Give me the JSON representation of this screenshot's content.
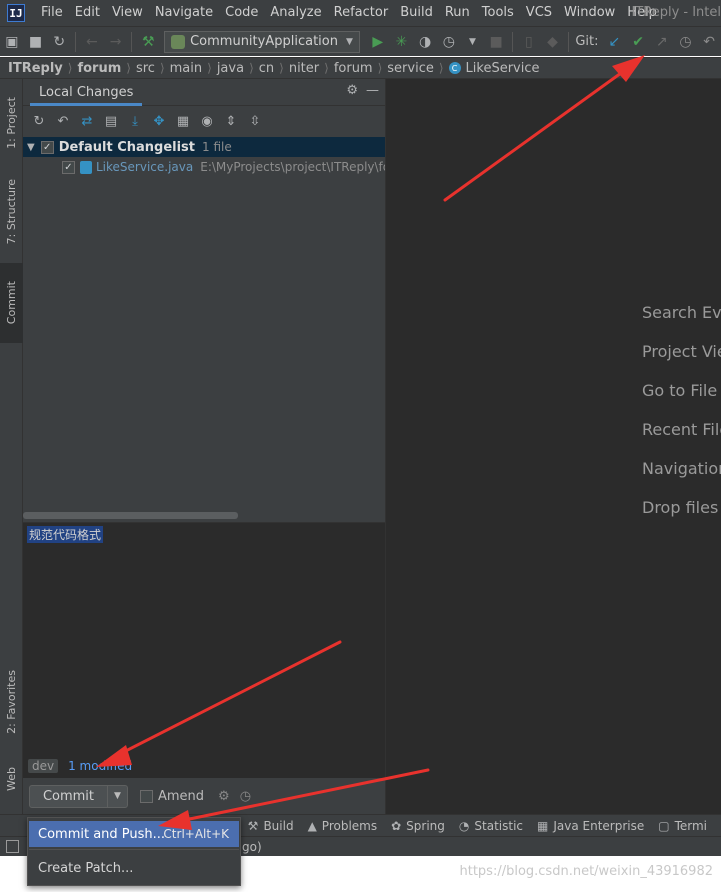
{
  "menubar": {
    "logo": "IJ",
    "items": [
      "File",
      "Edit",
      "View",
      "Navigate",
      "Code",
      "Analyze",
      "Refactor",
      "Build",
      "Run",
      "Tools",
      "VCS",
      "Window",
      "Help"
    ],
    "app_title": "ITReply - Intel"
  },
  "toolbar": {
    "run_config": "CommunityApplication",
    "git_label": "Git:"
  },
  "breadcrumb": [
    "ITReply",
    "forum",
    "src",
    "main",
    "java",
    "cn",
    "niter",
    "forum",
    "service",
    "LikeService"
  ],
  "left_stripe": {
    "project": "1: Project",
    "structure": "7: Structure",
    "commit": "Commit",
    "favorites": "2: Favorites",
    "web": "Web"
  },
  "commit_panel": {
    "tab_label": "Local Changes",
    "changelist_name": "Default Changelist",
    "changelist_count": "1 file",
    "file_name": "LikeService.java",
    "file_path": "E:\\MyProjects\\project\\ITReply\\fo",
    "commit_message": "规范代码格式",
    "branch": "dev",
    "modified": "1 modified",
    "commit_label": "Commit",
    "amend_label": "Amend"
  },
  "editor": {
    "hints": [
      "Search Eve",
      "Project Vie",
      "Go to File",
      "Recent File",
      "Navigation",
      "Drop files"
    ]
  },
  "bottom_bar": {
    "items": [
      {
        "icon": "hammer-icon",
        "label": "Build"
      },
      {
        "icon": "warning-icon",
        "label": "Problems"
      },
      {
        "icon": "spring-icon",
        "label": "Spring"
      },
      {
        "icon": "statistic-icon",
        "label": "Statistic"
      },
      {
        "icon": "java-enterprise-icon",
        "label": "Java Enterprise"
      },
      {
        "icon": "terminal-icon",
        "label": "Termi"
      }
    ]
  },
  "status_bar": {
    "text": "go)"
  },
  "popup": {
    "commit_push_label": "Commit and Push...",
    "commit_push_shortcut": "Ctrl+Alt+K",
    "create_patch_label": "Create Patch..."
  },
  "watermark": "https://blog.csdn.net/weixin_43916982",
  "colors": {
    "accent": "#4b6eaf",
    "panel": "#3c3f41",
    "editor": "#2b2b2b",
    "arrow": "#e8322d"
  }
}
